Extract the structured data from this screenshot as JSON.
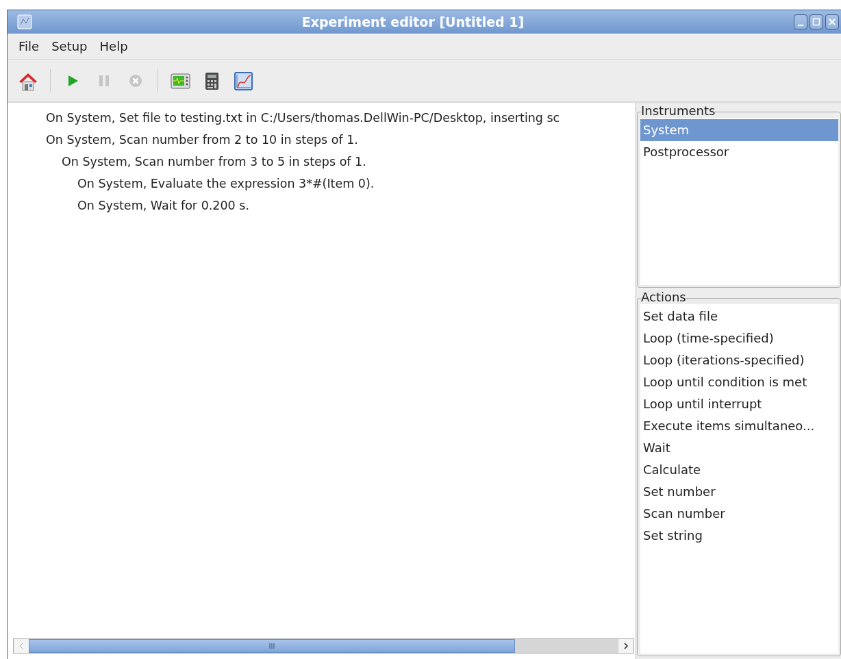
{
  "window": {
    "title": "Experiment editor [Untitled 1]"
  },
  "menu": [
    "File",
    "Setup",
    "Help"
  ],
  "toolbar": [
    {
      "kind": "home",
      "disabled": false
    },
    {
      "kind": "separator"
    },
    {
      "kind": "play",
      "disabled": false
    },
    {
      "kind": "pause",
      "disabled": true
    },
    {
      "kind": "stop",
      "disabled": true
    },
    {
      "kind": "separator"
    },
    {
      "kind": "monitor",
      "disabled": false
    },
    {
      "kind": "calculator",
      "disabled": false
    },
    {
      "kind": "graph",
      "disabled": false
    }
  ],
  "sequence": [
    {
      "text": "On System, Set file to testing.txt in C:/Users/thomas.DellWin-PC/Desktop, inserting sc"
    },
    {
      "text": "On System, Scan number from 2 to 10 in steps of 1.",
      "children": [
        {
          "text": "On System, Scan number from 3 to 5 in steps of 1.",
          "children": [
            {
              "text": "On System, Evaluate the expression 3*#(Item 0)."
            },
            {
              "text": "On System, Wait for 0.200 s."
            }
          ]
        }
      ]
    }
  ],
  "instruments": {
    "title": "Instruments",
    "items": [
      {
        "label": "System",
        "selected": true
      },
      {
        "label": "Postprocessor",
        "selected": false
      }
    ]
  },
  "actions": {
    "title": "Actions",
    "items": [
      {
        "label": "Set data file",
        "selected": false
      },
      {
        "label": "Loop (time-specified)",
        "selected": false
      },
      {
        "label": "Loop (iterations-specified)",
        "selected": false
      },
      {
        "label": "Loop until condition is met",
        "selected": false
      },
      {
        "label": "Loop until interrupt",
        "selected": false
      },
      {
        "label": "Execute items simultaneo...",
        "selected": false
      },
      {
        "label": "Wait",
        "selected": false
      },
      {
        "label": "Calculate",
        "selected": false
      },
      {
        "label": "Set number",
        "selected": false
      },
      {
        "label": "Scan number",
        "selected": false
      },
      {
        "label": "Set string",
        "selected": false
      }
    ]
  },
  "scrollbar_grip": "III"
}
